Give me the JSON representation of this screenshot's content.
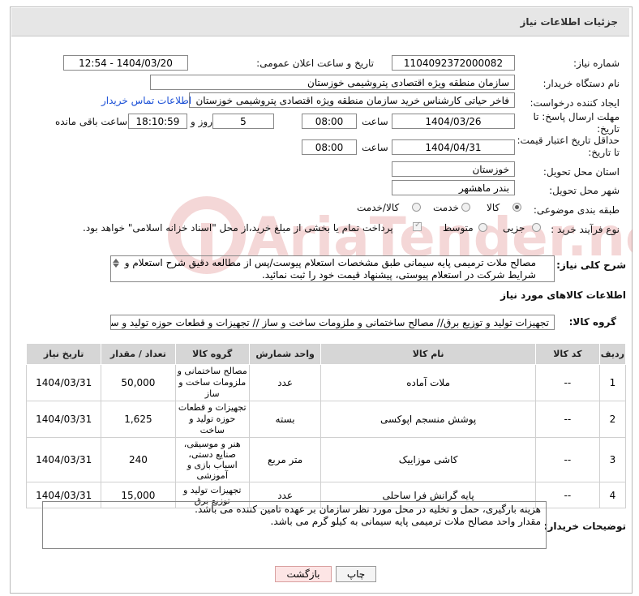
{
  "header": {
    "title": "جزئیات اطلاعات نیاز"
  },
  "fields": {
    "need_number_label": "شماره نیاز:",
    "need_number": "1104092372000082",
    "announce_label": "تاریخ و ساعت اعلان عمومی:",
    "announce_value": "1404/03/20 - 12:54",
    "buyer_org_label": "نام دستگاه خریدار:",
    "buyer_org": "سازمان منطقه ویژه اقتصادی پتروشیمی خوزستان",
    "creator_label": "ایجاد کننده درخواست:",
    "creator": "فاخر حیاتی کارشناس خرید سازمان منطقه ویژه اقتصادی پتروشیمی خوزستان",
    "contact_link": "اطلاعات تماس خریدار",
    "deadline_label": "مهلت ارسال پاسخ: تا تاریخ:",
    "deadline_date": "1404/03/26",
    "time_label": "ساعت",
    "deadline_time": "08:00",
    "days_value": "5",
    "days_label": "روز و",
    "remaining_time": "18:10:59",
    "remaining_label": "ساعت باقی مانده",
    "validity_label": "حداقل تاریخ اعتبار قیمت: تا تاریخ:",
    "validity_date": "1404/04/31",
    "validity_time": "08:00",
    "province_label": "استان محل تحویل:",
    "province": "خوزستان",
    "city_label": "شهر محل تحویل:",
    "city": "بندر ماهشهر",
    "category_label": "طبقه بندی موضوعی:",
    "category_options": [
      "کالا",
      "خدمت",
      "کالا/خدمت"
    ],
    "process_label": "نوع فرآیند خرید :",
    "process_options": [
      "جزیی",
      "متوسط"
    ],
    "payment_note": "پرداخت تمام یا بخشی از مبلغ خرید،از محل \"اسناد خزانه اسلامی\" خواهد بود."
  },
  "description": {
    "label": "شرح کلی نیاز:",
    "text": "مصالح ملات ترمیمی پایه سیمانی طبق مشخصات استعلام پیوست/پس از مطالعه دقیق شرح استعلام و شرایط شرکت در استعلام پیوستی، پیشنهاد قیمت خود را ثبت نمائید."
  },
  "goods_section": {
    "title": "اطلاعات کالاهای مورد نیاز",
    "group_label": "گروه کالا:",
    "group_value": "تجهیزات تولید و توزیع برق// مصالح ساختمانی و ملزومات ساخت و ساز // تجهیزات و قطعات حوزه تولید و ساخ"
  },
  "table": {
    "headers": [
      "ردیف",
      "کد کالا",
      "نام کالا",
      "واحد شمارش",
      "گروه کالا",
      "تعداد / مقدار",
      "تاریخ نیاز"
    ],
    "rows": [
      [
        "1",
        "--",
        "ملات آماده",
        "عدد",
        "مصالح ساختمانی و ملزومات ساخت و ساز",
        "50,000",
        "1404/03/31"
      ],
      [
        "2",
        "--",
        "پوشش منسجم اپوکسی",
        "بسته",
        "تجهیزات و قطعات حوزه تولید و ساخت",
        "1,625",
        "1404/03/31"
      ],
      [
        "3",
        "--",
        "کاشی موزاییک",
        "متر مربع",
        "هنر و موسیقی، صنایع دستی، اسباب بازی و آموزشی",
        "240",
        "1404/03/31"
      ],
      [
        "4",
        "--",
        "پایه گرانش فرا ساحلی",
        "عدد",
        "تجهیزات تولید و توزیع برق",
        "15,000",
        "1404/03/31"
      ]
    ]
  },
  "buyer_notes": {
    "label": "توضیحات خریدار:",
    "line1": "هزینه بارگیری، حمل و تخلیه در محل مورد نظر سازمان بر عهده تامین کننده می باشد.",
    "line2": "مقدار واحد مصالح ملات ترمیمی پایه سیمانی به کیلو گرم می باشد."
  },
  "buttons": {
    "print": "چاپ",
    "back": "بازگشت"
  },
  "watermark": {
    "text": "AriaTender.neT"
  }
}
